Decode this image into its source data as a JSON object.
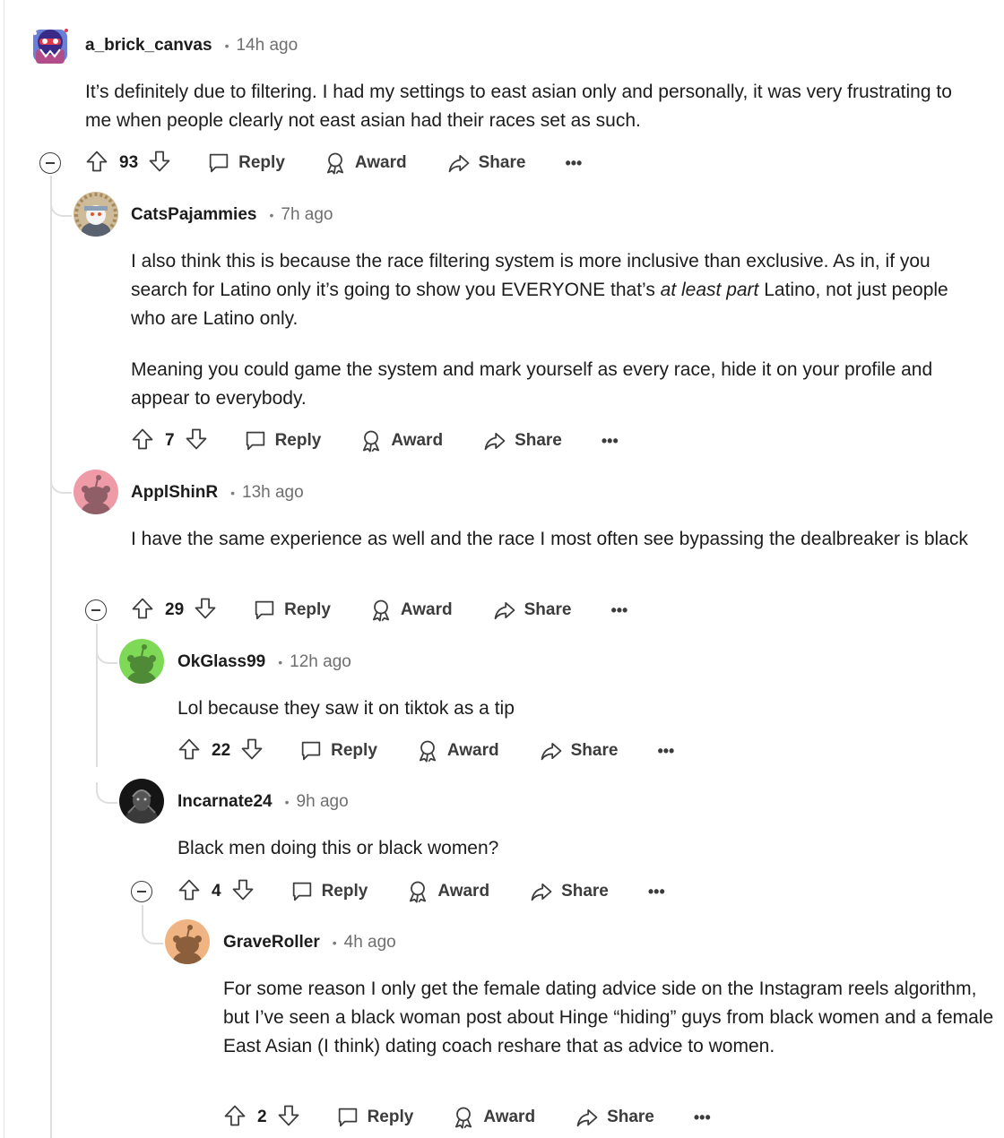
{
  "comments": [
    {
      "username": "a_brick_canvas",
      "time": "14h ago",
      "paragraphs": [
        "It’s definitely due to filtering. I had my settings to east asian only and personally, it was very frustrating to me when people clearly not east asian had their races set as such."
      ],
      "votes": "93",
      "avatar_bg": "#3b55c9"
    },
    {
      "username": "CatsPajammies",
      "time": "7h ago",
      "p1_a": "I also think this is because the race filtering system is more inclusive than exclusive. As in, if you search for Latino only it’s going to show you EVERYONE that’s ",
      "p1_em": "at least part",
      "p1_b": " Latino, not just people who are Latino only.",
      "p2": "Meaning you could game the system and mark yourself as every race, hide it on your profile and appear to everybody.",
      "votes": "7",
      "avatar_bg": "#c9b89a"
    },
    {
      "username": "ApplShinR",
      "time": "13h ago",
      "paragraphs": [
        "I have the same experience as well and the race I most often see bypassing the dealbreaker is black"
      ],
      "votes": "29",
      "avatar_bg": "#ef9aa7"
    },
    {
      "username": "OkGlass99",
      "time": "12h ago",
      "paragraphs": [
        "Lol because they saw it on tiktok as a tip"
      ],
      "votes": "22",
      "avatar_bg": "#7ed957"
    },
    {
      "username": "Incarnate24",
      "time": "9h ago",
      "paragraphs": [
        "Black men doing this or black women?"
      ],
      "votes": "4",
      "avatar_bg": "#1a1a1a"
    },
    {
      "username": "GraveRoller",
      "time": "4h ago",
      "paragraphs": [
        "For some reason I only get the female dating advice side on the Instagram reels algorithm, but I’ve seen a black woman post about Hinge “hiding” guys from black women and a female East Asian (I think) dating coach reshare that as advice to women."
      ],
      "votes": "2",
      "avatar_bg": "#f0b482"
    }
  ],
  "labels": {
    "reply": "Reply",
    "award": "Award",
    "share": "Share",
    "more": "•••",
    "separator": "•"
  },
  "icons": [
    "upvote-icon",
    "downvote-icon",
    "reply-icon",
    "award-icon",
    "share-icon",
    "more-icon",
    "collapse-icon"
  ]
}
